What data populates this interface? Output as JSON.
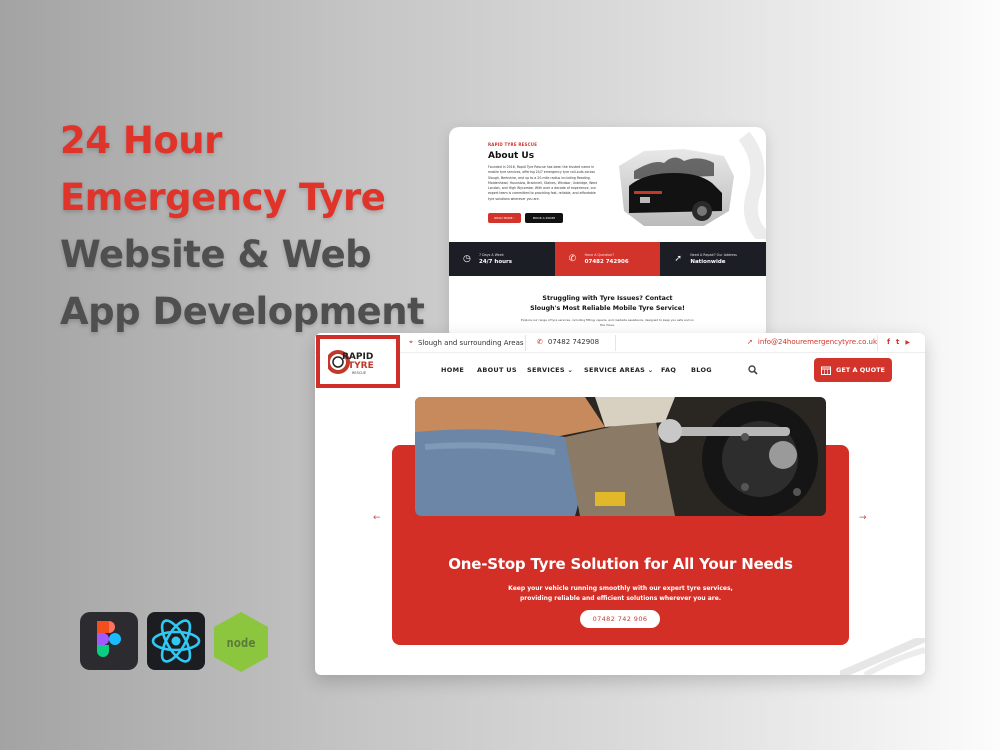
{
  "headline": {
    "line1": "24 Hour",
    "line2": "Emergency Tyre",
    "line3": "Website & Web",
    "line4": "App Development"
  },
  "colors": {
    "accent_red": "#d2332b",
    "headline_red": "#e0342a",
    "headline_dark": "#4f4f4f",
    "dark_navy": "#1c1e26"
  },
  "tech_stack": [
    {
      "name": "Figma",
      "icon": "figma-icon"
    },
    {
      "name": "React",
      "icon": "react-icon"
    },
    {
      "name": "node",
      "icon": "nodejs-icon"
    }
  ],
  "about_page": {
    "eyebrow": "RAPID TYRE RESCUE",
    "title": "About Us",
    "paragraph": "Founded in 2016, Rapid Tyre Rescue has been the trusted name in mobile tyre services, offering 24/7 emergency tyre call-outs across Slough, Berkshire, and up to a 20-mile radius including Reading, Maidenhead, Hounslow, Bracknell, Staines, Windsor, Uxbridge, West London, and High Wycombe. With over a decade of experience, our expert team is committed to providing fast, reliable, and affordable tyre solutions wherever you are.",
    "read_more_label": "READ MORE",
    "book_label": "BOOK A ROOM",
    "info_bar": [
      {
        "label": "7 Days A Week",
        "value": "24/7 hours",
        "icon": "clock-icon"
      },
      {
        "label": "Have A Question?",
        "value": "07482 742906",
        "icon": "phone-icon"
      },
      {
        "label": "Need A Repair? Our Address",
        "value": "Nationwide",
        "icon": "location-arrow-icon"
      }
    ],
    "section_title": "Struggling with Tyre Issues? Contact Slough's Most Reliable Mobile Tyre Service!",
    "section_sub": "Explore our range of tyre services, including fitting, repairs, and roadside assistance, designed to keep you safe and on the move."
  },
  "home_page": {
    "topbar": {
      "location": "Slough and surrounding Areas",
      "phone": "07482 742908",
      "email": "info@24houremergencytyre.co.uk",
      "social": [
        "f",
        "t",
        "▶"
      ]
    },
    "logo": {
      "line1": "RAPID",
      "line2": "TYRE",
      "line3": "RESCUE"
    },
    "nav": [
      {
        "label": "HOME"
      },
      {
        "label": "ABOUT US"
      },
      {
        "label": "SERVICES ⌄"
      },
      {
        "label": "SERVICE AREAS ⌄"
      },
      {
        "label": "FAQ"
      },
      {
        "label": "BLOG"
      }
    ],
    "quote_label": "GET A QUOTE",
    "hero": {
      "title": "One-Stop Tyre Solution for All Your Needs",
      "subtitle_line1": "Keep your vehicle running smoothly with our expert tyre services,",
      "subtitle_line2": "providing reliable and efficient solutions wherever you are.",
      "cta": "07482 742 906",
      "prev": "←",
      "next": "→"
    }
  }
}
